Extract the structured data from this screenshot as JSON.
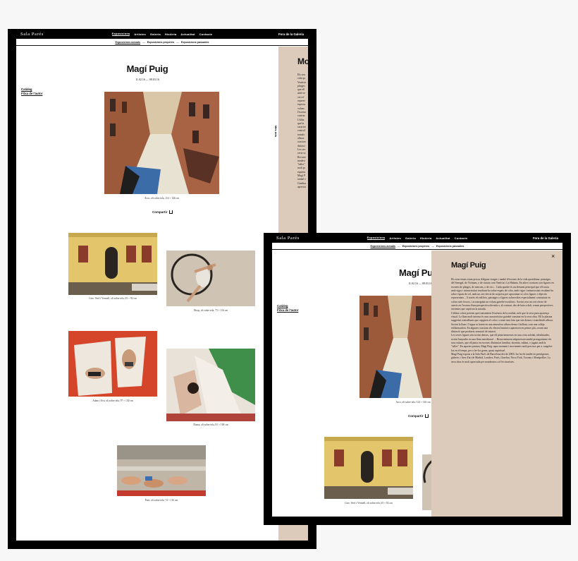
{
  "site": {
    "brand": "Sala Parés",
    "nav": [
      "Exposicions",
      "Artistes",
      "Galeria",
      "Història",
      "Actualitat",
      "Contacte"
    ],
    "nav_active": 0,
    "fair": "Fora de la Galeria",
    "subnav": [
      "Exposicions actuals",
      "Exposicions properes",
      "Exposicions passades"
    ],
    "subnav_sep": "—"
  },
  "exhibition": {
    "artist": "Magí Puig",
    "dates": "11.02.16 — 08.03.16",
    "side_links": [
      "Catàleg",
      "Fitxa de l'autor"
    ],
    "vertical_tab": "Més info",
    "share_label": "Compartir",
    "share_icon": "share-icon"
  },
  "artworks": [
    {
      "caption": "Arco, oli sobre tela, 114 × 146 cm",
      "subject": "venice-canal"
    },
    {
      "caption": "Giro. Verd i Vermell, oli sobre tela, 65 × 92 cm",
      "subject": "venice-facade"
    },
    {
      "caption": "Hoop, oli sobre tela, 73 × 116 cm",
      "subject": "aerial-hoop"
    },
    {
      "caption": "Adam i Eva, oli sobre tela, 97 × 130 cm",
      "subject": "beach-figures"
    },
    {
      "caption": "Dansa, oli sobre tela, 81 × 100 cm",
      "subject": "dancers-flag"
    },
    {
      "caption": "Pont, oli sobre tela, 74 × 116 cm",
      "subject": "sunbathers"
    }
  ],
  "side_panel_peek": {
    "title": "Mo",
    "text": [
      "Els seu",
      "vida qu",
      "Venècia",
      "platges",
      "que ell",
      "amb ve",
      "cert ef",
      "represe",
      "especia",
      "volum",
      "l'escena",
      "contrar",
      "Utilitz",
      "que la",
      "caracter",
      "control",
      "transfo",
      "alhora",
      "ocasion",
      "distinci",
      "Les sev",
      "certa so",
      "Recurre",
      "modest",
      "\"taller\"",
      "molt pr",
      "espiritu",
      "Magí P",
      "també e",
      "Ginebra",
      "apreciat"
    ]
  },
  "modal": {
    "title": "Magí Puig",
    "close_glyph": "×",
    "paragraphs": [
      "Els seus temes estan presos d'alguns viatges i també d'escenes de la vida quotidiana: paisatges del Senegal, de Vietnam, o de ciutats com Venècia i La Habana. En altres ocasions son figures en escenes de platges, de mercats, o de circ... Cada quadre és un element principal que ell tracta amb vigor i minuciositat resultant-ho sobre espais de color, amb vigor i minuciositat resultant-ho sobre espais de cel, amb un cert efecte de sorpresa per aproximar-se a les figures i objectes representats... A través els edificis, paisatges o figures sobrevoltes especialment contrastats en colors més foscos, i aconseguint un volum gairebé escultòric. Sovint crea un cert efecte de canvis en l'escena d'una perspectiva elevada o, al contrari, des de baix a dalt, creant perspectives extremes que captiven la mirada.",
      "Utilitza colors potents que transmeten l'essència de la realitat, més que la seva pura aparença visual. La llum molt intensa és una característica gairebé constant en la seva obra. Ell la plasma suggerint contrallums que capgiren el color i creant una fons que són densos i translúcids alhora. Sovint la llum i l'aigua es fonen en una atmosfera alhora densa i brillant, com una calitja enlluernadora. En algunes ocasions els efectes lumínics apareixen en primer pla, creant una distinció que produeix sensació de misteri.",
      "Les seves figures són sovint denses, que ell pinta immerses en una certa soledat, idealitzades, sovint banyades en una llum meridional ... Recurrentment adquireixen també protagonisme els seus infants, que ell pinta en escenes d'intimitat familiar, dormint, sallant, o jugant amb la \"taller\". En aquesta pintura, Magí Puig capta moment i moviments molt precisos per a congelar-los en el temps, per a fer-los grans, quasi espiritual.",
      "Magí Puig exposa a la Sala Parés de Barcelona des de 2003 i ho ha fet també en prestigioses galeries i fires d'art de Madrid, Londres, París, Ginebra, Nova York, Toronto i Montpellier. La seva obra és molt apreciada per nombrosos col·leccionistes."
    ]
  },
  "colors": {
    "frame": "#000000",
    "panel": "#dccabb",
    "canvas": "#f7f7f7"
  }
}
